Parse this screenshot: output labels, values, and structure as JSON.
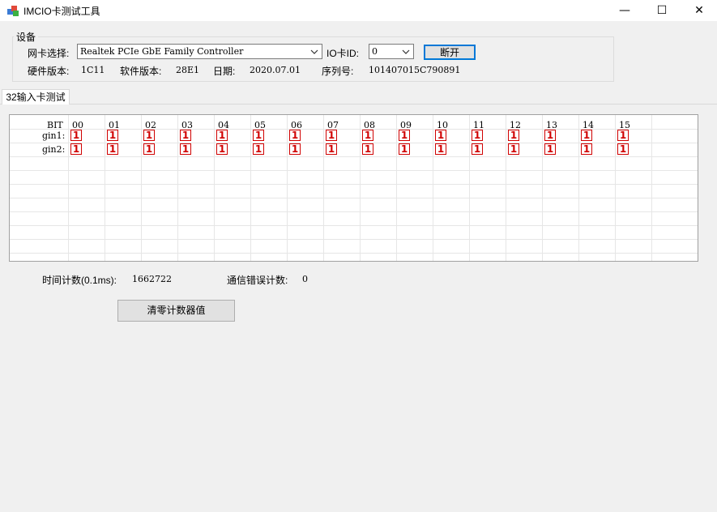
{
  "window": {
    "title": "IMCIO卡测试工具",
    "min_glyph": "—",
    "max_glyph": "☐",
    "close_glyph": "✕"
  },
  "device": {
    "legend": "设备",
    "nic_label": "网卡选择:",
    "nic_value": "Realtek PCIe GbE Family Controller",
    "ioid_label": "IO卡ID:",
    "ioid_value": "0",
    "connect_button": "断开",
    "hw_label": "硬件版本:",
    "hw_value": "1C11",
    "sw_label": "软件版本:",
    "sw_value": "28E1",
    "date_label": "日期:",
    "date_value": "2020.07.01",
    "serial_label": "序列号:",
    "serial_value": "101407015C790891"
  },
  "tab": {
    "label": "32输入卡测试"
  },
  "grid": {
    "header_label": "BIT",
    "bits": [
      "00",
      "01",
      "02",
      "03",
      "04",
      "05",
      "06",
      "07",
      "08",
      "09",
      "10",
      "11",
      "12",
      "13",
      "14",
      "15"
    ],
    "rows": [
      {
        "label": "gin1:",
        "values": [
          "1",
          "1",
          "1",
          "1",
          "1",
          "1",
          "1",
          "1",
          "1",
          "1",
          "1",
          "1",
          "1",
          "1",
          "1",
          "1"
        ]
      },
      {
        "label": "gin2:",
        "values": [
          "1",
          "1",
          "1",
          "1",
          "1",
          "1",
          "1",
          "1",
          "1",
          "1",
          "1",
          "1",
          "1",
          "1",
          "1",
          "1"
        ]
      }
    ],
    "total_rows": 10,
    "colors": {
      "bit_on": "#d00000",
      "gridline": "#e6e6e6"
    }
  },
  "stats": {
    "time_label": "时间计数(0.1ms):",
    "time_value": "1662722",
    "err_label": "通信错误计数:",
    "err_value": "0"
  },
  "clear_button": "清零计数器值"
}
